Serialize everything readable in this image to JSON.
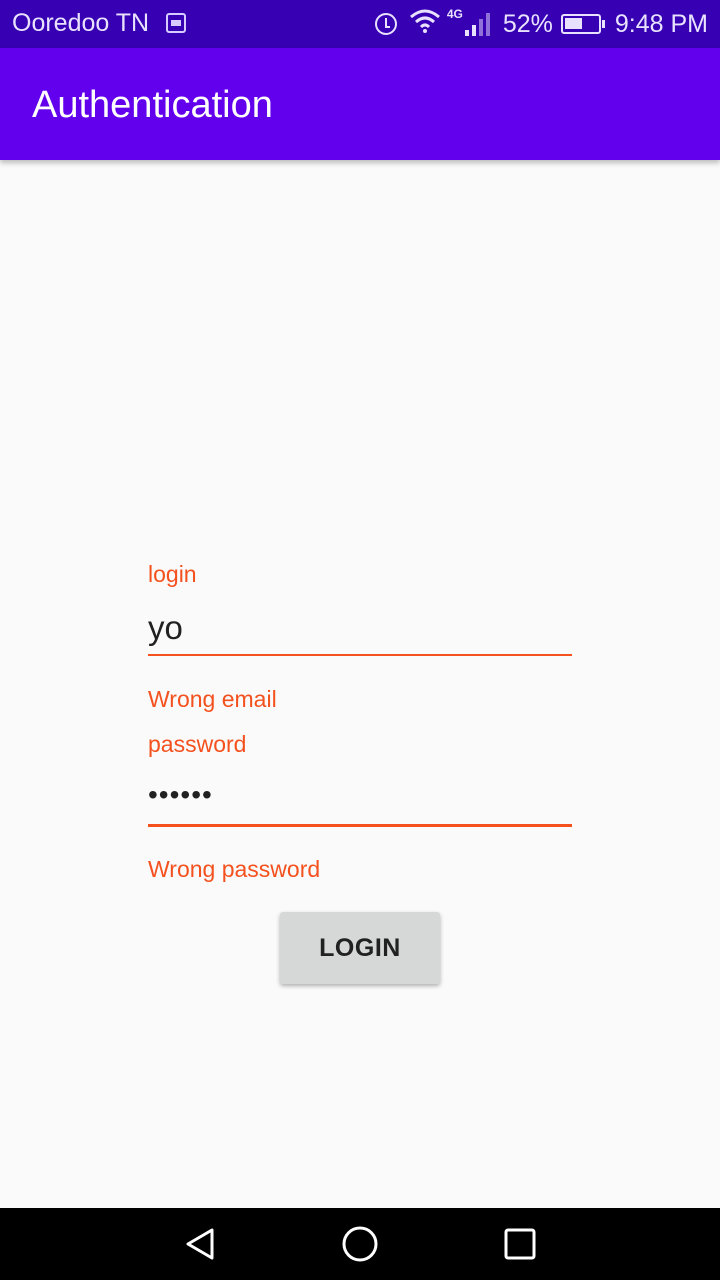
{
  "status_bar": {
    "carrier": "Ooredoo TN",
    "network_type": "4G",
    "battery_percent": "52%",
    "time": "9:48 PM",
    "icons": [
      "image-notification-icon",
      "alarm-icon",
      "wifi-icon",
      "signal-icon",
      "battery-icon"
    ]
  },
  "app_bar": {
    "title": "Authentication"
  },
  "form": {
    "login_label": "login",
    "login_value": "yo",
    "login_error": "Wrong email",
    "password_label": "password",
    "password_value": "••••••",
    "password_error": "Wrong password",
    "submit_label": "LOGIN"
  },
  "nav_bar": {
    "icons": [
      "back-icon",
      "home-icon",
      "recents-icon"
    ]
  },
  "colors": {
    "status_bar": "#3700b3",
    "app_bar": "#6200ee",
    "error": "#f4511e",
    "background": "#fafafa",
    "button": "#d6d7d7"
  }
}
